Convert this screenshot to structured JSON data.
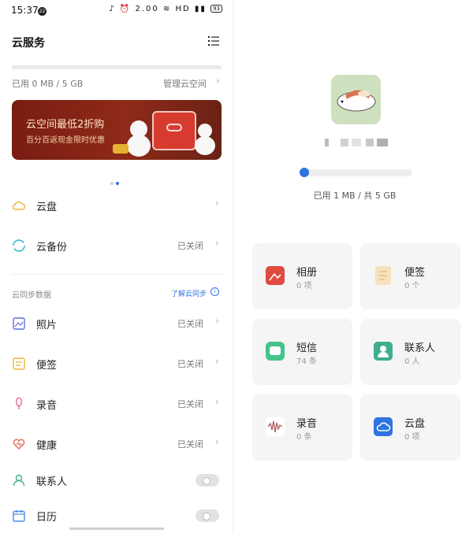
{
  "status_bar": {
    "time": "15:37",
    "badge": "22",
    "icons": "♪ ⏰ 2.00 ≋ HD ▮▮",
    "battery": "93"
  },
  "header": {
    "title": "云服务"
  },
  "storage": {
    "usage_text": "已用 0 MB / 5 GB",
    "manage_label": "管理云空间"
  },
  "banner": {
    "title": "云空间最低2折购",
    "subtitle": "百分百返现金限时优惠"
  },
  "carousel": {
    "active_index": 1,
    "count": 2
  },
  "main_items": [
    {
      "label": "云盘",
      "status": "",
      "icon": "cloud-icon"
    },
    {
      "label": "云备份",
      "status": "已关闭",
      "icon": "sync-icon"
    }
  ],
  "sync_section": {
    "title": "云同步数据",
    "learn_label": "了解云同步"
  },
  "sync_items": [
    {
      "label": "照片",
      "status": "已关闭",
      "icon": "photo-icon",
      "control": "chevron"
    },
    {
      "label": "便签",
      "status": "已关闭",
      "icon": "note-icon",
      "control": "chevron"
    },
    {
      "label": "录音",
      "status": "已关闭",
      "icon": "microphone-icon",
      "control": "chevron"
    },
    {
      "label": "健康",
      "status": "已关闭",
      "icon": "health-heart-icon",
      "control": "chevron"
    },
    {
      "label": "联系人",
      "status": "",
      "icon": "contact-icon",
      "control": "toggle"
    },
    {
      "label": "日历",
      "status": "",
      "icon": "calendar-icon",
      "control": "toggle"
    }
  ],
  "right_panel": {
    "usage_text": "已用 1 MB / 共 5 GB",
    "usage_fraction": 0.0002,
    "cards": [
      {
        "name": "相册",
        "count": "0 项",
        "icon": "album-icon",
        "color": "#e04a40"
      },
      {
        "name": "便签",
        "count": "0 个",
        "icon": "note-icon",
        "color": "#f7e2bf"
      },
      {
        "name": "短信",
        "count": "74 条",
        "icon": "message-icon",
        "color": "#43c48a"
      },
      {
        "name": "联系人",
        "count": "0 人",
        "icon": "contact-icon",
        "color": "#3fae8e"
      },
      {
        "name": "录音",
        "count": "0 条",
        "icon": "recording-icon",
        "color": "#f0e4e4"
      },
      {
        "name": "云盘",
        "count": "0 项",
        "icon": "cloud-drive-icon",
        "color": "#2f74e0"
      }
    ]
  },
  "colors": {
    "accent": "#2f74e0",
    "banner": "#8e2a18",
    "text": "#222222",
    "muted": "#777777"
  }
}
